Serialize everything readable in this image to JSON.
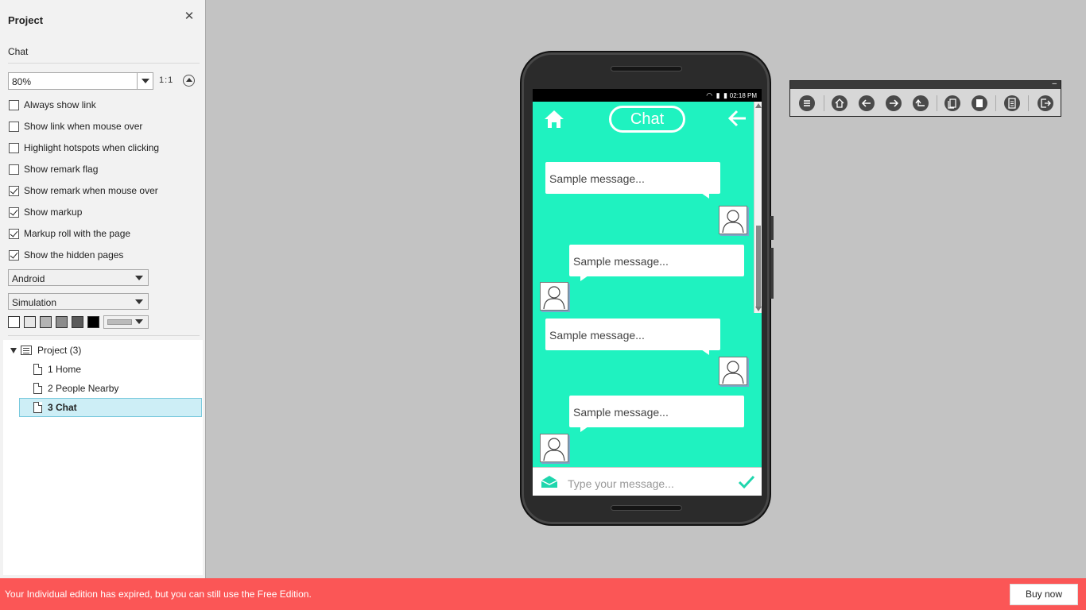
{
  "sidebar": {
    "title": "Project",
    "page_name": "Chat",
    "zoom": "80%",
    "ratio": "1:1",
    "options": [
      {
        "label": "Always show link",
        "checked": false
      },
      {
        "label": "Show link when mouse over",
        "checked": false
      },
      {
        "label": "Highlight hotspots when clicking",
        "checked": false
      },
      {
        "label": "Show remark flag",
        "checked": false
      },
      {
        "label": "Show remark when mouse over",
        "checked": true
      },
      {
        "label": "Show markup",
        "checked": true
      },
      {
        "label": "Markup roll with the page",
        "checked": true
      },
      {
        "label": "Show the hidden pages",
        "checked": true
      }
    ],
    "device_select": "Android",
    "mode_select": "Simulation",
    "swatches": [
      "#ffffff",
      "#e6e6e6",
      "#b4b4b4",
      "#8c8c8c",
      "#5a5a5a",
      "#000000"
    ],
    "tree": {
      "root": "Project (3)",
      "pages": [
        "1 Home",
        "2 People Nearby",
        "3 Chat"
      ],
      "selected": 2
    }
  },
  "phone": {
    "status_time": "02:18 PM",
    "header_title": "Chat",
    "messages": [
      {
        "text": "Sample message...",
        "side": "right"
      },
      {
        "text": "Sample message...",
        "side": "left"
      },
      {
        "text": "Sample message...",
        "side": "right"
      },
      {
        "text": "Sample message...",
        "side": "left"
      }
    ],
    "input_placeholder": "Type your message..."
  },
  "toolbar": {
    "icons": [
      "menu-icon",
      "home-icon",
      "arrow-left-icon",
      "arrow-right-icon",
      "return-icon",
      "page-copy-icon",
      "pages-icon",
      "document-icon",
      "exit-icon"
    ]
  },
  "banner": {
    "message": "Your Individual edition has expired, but you can still use the Free Edition.",
    "buy_label": "Buy now",
    "color": "#fb5656"
  },
  "colors": {
    "screen_bg": "#1ff2c0",
    "canvas_bg": "#c3c3c3"
  }
}
